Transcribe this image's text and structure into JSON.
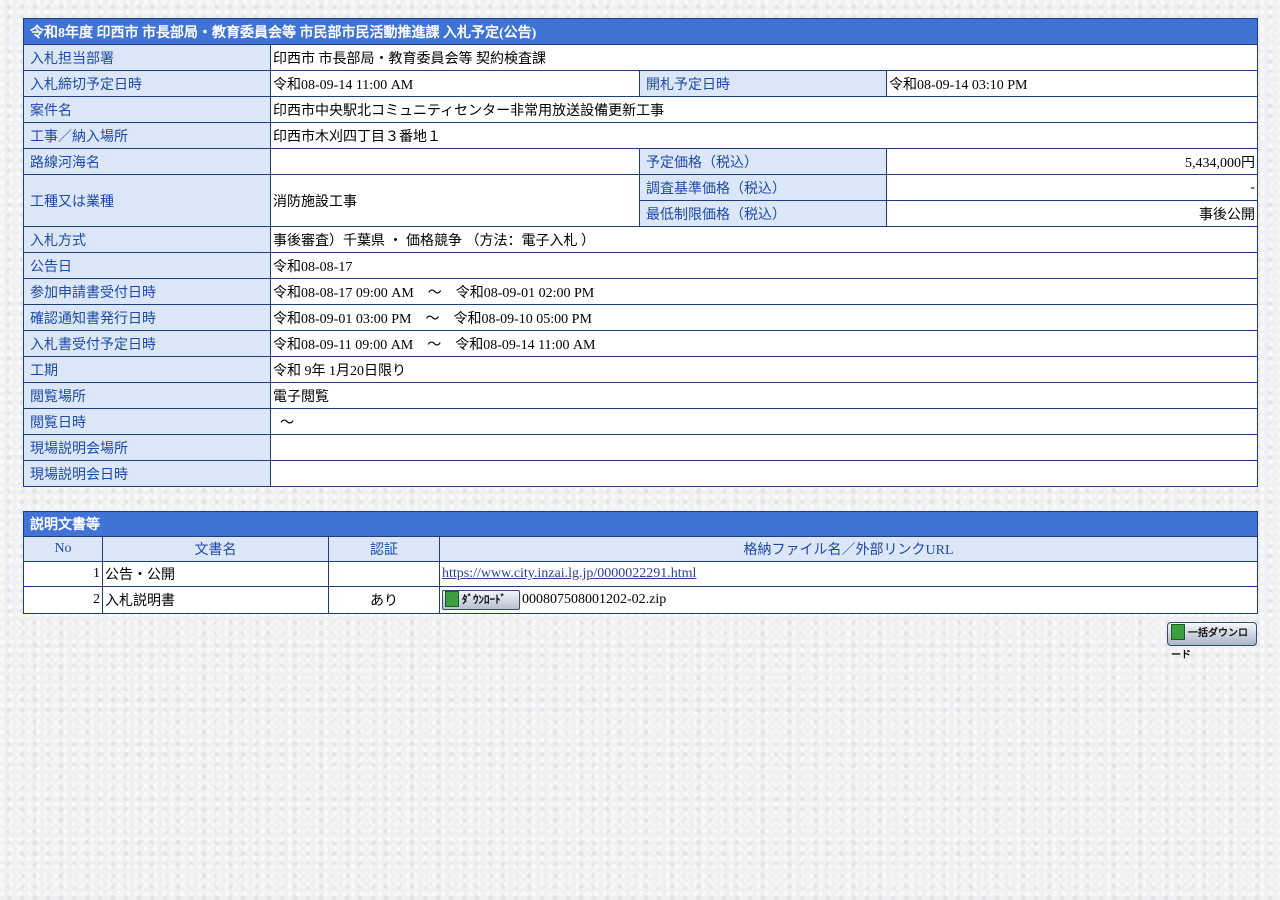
{
  "main_table": {
    "title": "令和8年度  印西市  市長部局・教育委員会等  市民部市民活動推進課  入札予定(公告)",
    "rows": [
      {
        "label": "入札担当部署",
        "value": "印西市  市長部局・教育委員会等  契約検査課"
      },
      {
        "label": "入札締切予定日時",
        "value": "令和08-09-14 11:00 AM",
        "label2": "開札予定日時",
        "value2": "令和08-09-14 03:10 PM"
      },
      {
        "label": "案件名",
        "value": "印西市中央駅北コミュニティセンター非常用放送設備更新工事"
      },
      {
        "label": "工事／納入場所",
        "value": "印西市木刈四丁目３番地１"
      },
      {
        "label": "路線河海名",
        "value": "",
        "label2": "予定価格（税込）",
        "value2": "5,434,000円"
      },
      {
        "label": "工種又は業種",
        "value": "消防施設工事",
        "label2": "調査基準価格（税込）",
        "value2": "-",
        "label3": "最低制限価格（税込）",
        "value3": "事後公開"
      },
      {
        "label": "入札方式",
        "value": "事後審査）千葉県 ・ 価格競争 （方法：電子入札 ）"
      },
      {
        "label": "公告日",
        "value": "令和08-08-17"
      },
      {
        "label": "参加申請書受付日時",
        "value": "令和08-08-17 09:00 AM    ～    令和08-09-01 02:00 PM"
      },
      {
        "label": "確認通知書発行日時",
        "value": "令和08-09-01 03:00 PM    ～    令和08-09-10 05:00 PM"
      },
      {
        "label": "入札書受付予定日時",
        "value": "令和08-09-11 09:00 AM    ～    令和08-09-14 11:00 AM"
      },
      {
        "label": "工期",
        "value": "令和 9年 1月20日限り"
      },
      {
        "label": "閲覧場所",
        "value": "電子閲覧"
      },
      {
        "label": "閲覧日時",
        "value": "  ～"
      },
      {
        "label": "現場説明会場所",
        "value": ""
      },
      {
        "label": "現場説明会日時",
        "value": ""
      }
    ]
  },
  "docs_table": {
    "title": "説明文書等",
    "headers": [
      "No",
      "文書名",
      "認証",
      "格納ファイル名／外部リンクURL"
    ],
    "rows": [
      {
        "no": "1",
        "name": "公告・公開",
        "auth": "",
        "link": "https://www.city.inzai.lg.jp/0000022291.html"
      },
      {
        "no": "2",
        "name": "入札説明書",
        "auth": "あり",
        "button": "ﾀﾞｳﾝﾛｰﾄﾞ",
        "file": "000807508001202-02.zip"
      }
    ]
  },
  "bulk_download_label": "一括ダウンロード",
  "colors": {
    "header_bg": "#3f73d6",
    "label_bg": "#dbe6f6",
    "label_text": "#1f4aa8",
    "border": "#1f3d7a"
  },
  "icons": {
    "download": "download-icon",
    "bulk_download": "download-icon"
  }
}
